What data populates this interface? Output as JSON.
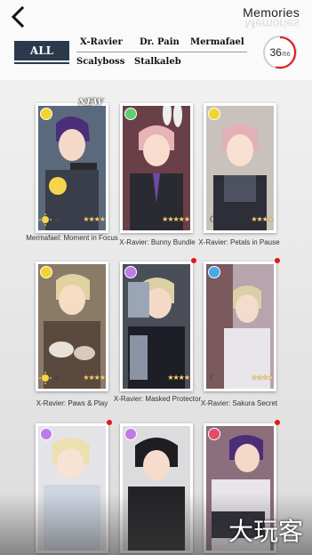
{
  "header": {
    "title": "Memories",
    "counter": {
      "current": "36",
      "total": "/66",
      "fraction": 0.545
    }
  },
  "filters": {
    "all": "ALL",
    "items": [
      "X-Ravier",
      "Dr. Pain",
      "Mermafael",
      "Scalyboss",
      "Stalkaleb"
    ]
  },
  "cards": [
    {
      "caption": "Mermafael: Moment in Focus",
      "badge": "NEW",
      "attr_color": "#f2d42e",
      "stars": "★★★★",
      "has_reddot": false
    },
    {
      "caption": "X-Ravier: Bunny Bundle",
      "attr_color": "#5fce6e",
      "stars": "★★★★★",
      "has_reddot": false
    },
    {
      "caption": "X-Ravier: Petals in Pause",
      "attr_color": "#f2d42e",
      "stars": "★★★★",
      "has_reddot": false
    },
    {
      "caption": "X-Ravier: Paws & Play",
      "attr_color": "#f2d42e",
      "stars": "★★★★",
      "has_reddot": false
    },
    {
      "caption": "X-Ravier: Masked Protector",
      "attr_color": "#c07ae8",
      "stars": "★★★★",
      "has_reddot": true
    },
    {
      "caption": "X-Ravier: Sakura Secret",
      "attr_color": "#4aa8e8",
      "stars": "★★★★",
      "has_reddot": true
    },
    {
      "caption": "",
      "attr_color": "#c07ae8",
      "stars": "",
      "has_reddot": true
    },
    {
      "caption": "",
      "attr_color": "#c07ae8",
      "stars": "",
      "has_reddot": false
    },
    {
      "caption": "",
      "attr_color": "#e64a6b",
      "stars": "",
      "has_reddot": true
    }
  ],
  "watermark": "大玩客",
  "colors": {
    "tab_bg": "#2a3a4c",
    "counter_arc": "#e01818"
  }
}
